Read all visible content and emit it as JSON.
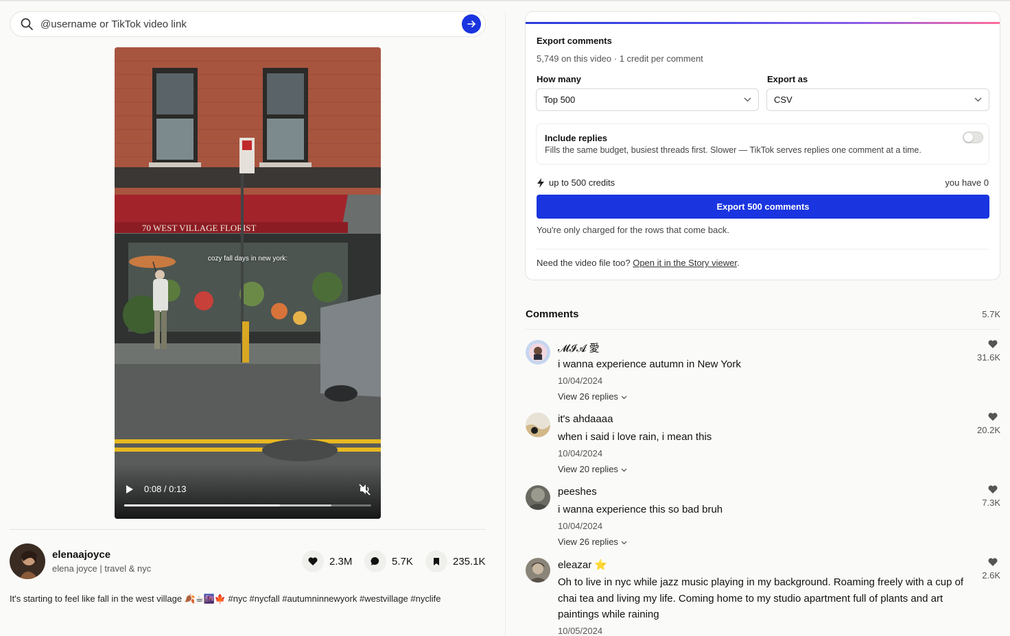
{
  "search": {
    "placeholder": "@username or TikTok video link"
  },
  "video": {
    "overlay_text": "cozy fall days in new york:",
    "store_sign": "70    WEST VILLAGE FLORIST",
    "time": "0:08 / 0:13",
    "progress_fraction": 0.63,
    "buffered_fraction": 0.84
  },
  "author": {
    "username": "elenaajoyce",
    "bio": "elena joyce | travel & nyc",
    "likes": "2.3M",
    "comments": "5.7K",
    "saves": "235.1K"
  },
  "description": "It's starting to feel like fall in the west village 🍂☕🌆🍁 #nyc #nycfall #autumninnewyork #westvillage #nyclife",
  "export": {
    "title": "Export comments",
    "subtitle": "5,749 on this video · 1 credit per comment",
    "how_many_label": "How many",
    "how_many_value": "Top 500",
    "export_as_label": "Export as",
    "export_as_value": "CSV",
    "replies_title": "Include replies",
    "replies_desc": "Fills the same budget, busiest threads first. Slower — TikTok serves replies one comment at a time.",
    "replies_enabled": false,
    "credits_text": "up to 500 credits",
    "balance_text": "you have 0",
    "button_label": "Export 500 comments",
    "charged_note": "You're only charged for the rows that come back.",
    "need_text": "Need the video file too? ",
    "need_link": "Open it in the Story viewer",
    "need_end": ".",
    "accent": "#1a35e0"
  },
  "comments": {
    "title": "Comments",
    "count": "5.7K",
    "items": [
      {
        "user": "𝓜𝓘𝓐 愛",
        "text": "i wanna experience autumn in New York",
        "date": "10/04/2024",
        "replies": "View 26 replies",
        "likes": "31.6K"
      },
      {
        "user": "it's ahdaaaa",
        "text": "when i said i love rain, i mean this",
        "date": "10/04/2024",
        "replies": "View 20 replies",
        "likes": "20.2K"
      },
      {
        "user": "peeshes",
        "text": "i wanna experience this so bad bruh",
        "date": "10/04/2024",
        "replies": "View 26 replies",
        "likes": "7.3K"
      },
      {
        "user": "eleazar ⭐",
        "text": "Oh to live in nyc while jazz music playing in my background. Roaming freely with a cup of chai tea and living my life. Coming home to my studio apartment full of plants and art paintings while raining",
        "date": "10/05/2024",
        "replies": "",
        "likes": "2.6K"
      }
    ]
  }
}
